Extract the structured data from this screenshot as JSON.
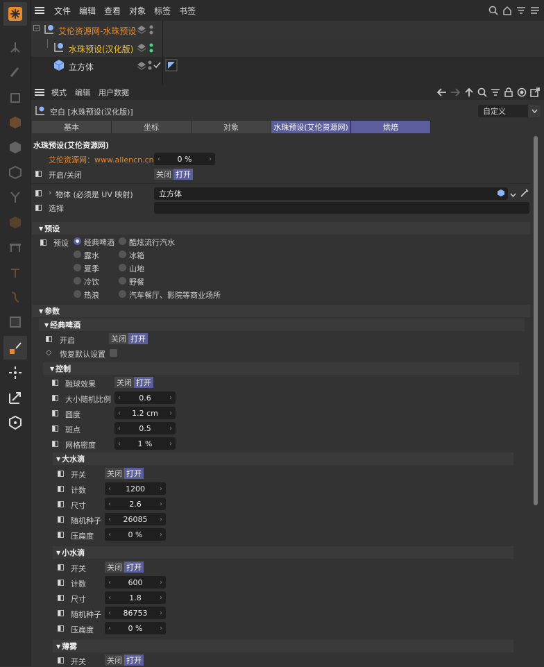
{
  "menubar": {
    "items": [
      "文件",
      "编辑",
      "查看",
      "对象",
      "标签",
      "书签"
    ]
  },
  "objects": [
    {
      "name": "艾伦资源网-水珠预设",
      "color": "#e58a2e"
    },
    {
      "name": "水珠预设(汉化版)",
      "color": "#f2c230"
    },
    {
      "name": "立方体",
      "color": "#d8d8d8"
    }
  ],
  "attr_menu": {
    "items": [
      "模式",
      "编辑",
      "用户数据"
    ]
  },
  "header": {
    "title": "空白 [水珠预设(汉化版)]",
    "dropdown": "自定义"
  },
  "tabs": [
    "基本",
    "坐标",
    "对象",
    "水珠预设(艾伦资源网)",
    "烘焙"
  ],
  "group_title": "水珠预设(艾伦资源网)",
  "site": {
    "label": "艾伦资源网：www.allencn.cn",
    "value": "0 %"
  },
  "enable": {
    "label": "开启/关闭"
  },
  "obj_field": {
    "label": "物体 (必须是 UV 映射)",
    "value": "立方体"
  },
  "select": {
    "label": "选择"
  },
  "toggle": {
    "off": "关闭",
    "on": "打开"
  },
  "preset_section": "预设",
  "preset_label": "预设",
  "presets": [
    [
      "经典啤酒",
      "酷炫流行汽水"
    ],
    [
      "露水",
      "冰箱"
    ],
    [
      "夏季",
      "山地"
    ],
    [
      "冷饮",
      "野餐"
    ],
    [
      "热浪",
      "汽车餐厅、影院等商业场所"
    ]
  ],
  "params_section": "参数",
  "classic_section": "经典啤酒",
  "open_label": "开启",
  "reset_label": "恢复默认设置",
  "control_section": "控制",
  "control_rows": [
    {
      "label": "融球效果",
      "type": "toggle"
    },
    {
      "label": "大小随机比例",
      "value": "0.6"
    },
    {
      "label": "圆度",
      "value": "1.2 cm"
    },
    {
      "label": "斑点",
      "value": "0.5"
    },
    {
      "label": "网格密度",
      "value": "1 %"
    }
  ],
  "big_section": "大水滴",
  "big_rows": [
    {
      "label": "开关",
      "type": "toggle"
    },
    {
      "label": "计数",
      "value": "1200"
    },
    {
      "label": "尺寸",
      "value": "2.6"
    },
    {
      "label": "随机种子",
      "value": "26085"
    },
    {
      "label": "压扁度",
      "value": "0 %"
    }
  ],
  "small_section": "小水滴",
  "small_rows": [
    {
      "label": "开关",
      "type": "toggle"
    },
    {
      "label": "计数",
      "value": "600"
    },
    {
      "label": "尺寸",
      "value": "1.8"
    },
    {
      "label": "随机种子",
      "value": "86753"
    },
    {
      "label": "压扁度",
      "value": "0 %"
    }
  ],
  "mist_section": "薄雾",
  "mist_row": {
    "label": "开关"
  },
  "colors": {
    "accent": "#5b5e9a",
    "orange": "#e58a2e",
    "yellow": "#f2c230",
    "green": "#3ddc84"
  }
}
